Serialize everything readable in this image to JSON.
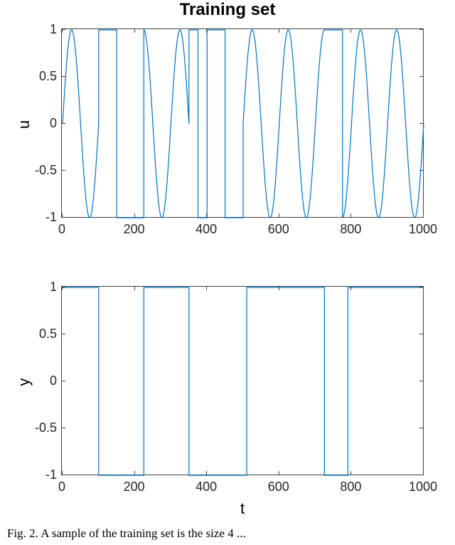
{
  "title": "Training set",
  "caption": "Fig. 2.  A sample of the training set is the size 4 ...",
  "chart_data": [
    {
      "type": "line",
      "title": "Training set",
      "xlabel": "",
      "ylabel": "u",
      "xlim": [
        0,
        1000
      ],
      "ylim": [
        -1,
        1
      ],
      "xticks": [
        0,
        200,
        400,
        600,
        800,
        1000
      ],
      "yticks": [
        -1,
        -0.5,
        0,
        0.5,
        1
      ],
      "description": "sinusoid (period≈100) alternating or clipped to a square wave at ±1",
      "segments": [
        {
          "kind": "sin",
          "from": 0,
          "to": 100,
          "period": 100
        },
        {
          "kind": "square",
          "from": 100,
          "to": 150,
          "value": 1
        },
        {
          "kind": "square",
          "from": 150,
          "to": 225,
          "value": -1
        },
        {
          "kind": "sin",
          "from": 225,
          "to": 350,
          "period": 100,
          "phase": 25
        },
        {
          "kind": "square",
          "from": 350,
          "to": 375,
          "value": 1
        },
        {
          "kind": "square",
          "from": 375,
          "to": 400,
          "value": -1
        },
        {
          "kind": "square",
          "from": 400,
          "to": 450,
          "value": 1
        },
        {
          "kind": "square",
          "from": 450,
          "to": 500,
          "value": -1
        },
        {
          "kind": "sin",
          "from": 500,
          "to": 725,
          "period": 100,
          "phase": 0
        },
        {
          "kind": "square",
          "from": 725,
          "to": 775,
          "value": 1
        },
        {
          "kind": "sin",
          "from": 775,
          "to": 1000,
          "period": 100,
          "phase": 75
        }
      ]
    },
    {
      "type": "line",
      "title": "",
      "xlabel": "t",
      "ylabel": "y",
      "xlim": [
        0,
        1000
      ],
      "ylim": [
        -1,
        1
      ],
      "xticks": [
        0,
        200,
        400,
        600,
        800,
        1000
      ],
      "yticks": [
        -1,
        -0.5,
        0,
        0.5,
        1
      ],
      "description": "piecewise constant at ±1 (step response)",
      "steps": [
        {
          "t": 0,
          "y": 1
        },
        {
          "t": 100,
          "y": -1
        },
        {
          "t": 225,
          "y": 1
        },
        {
          "t": 350,
          "y": -1
        },
        {
          "t": 510,
          "y": 1
        },
        {
          "t": 725,
          "y": -1
        },
        {
          "t": 790,
          "y": 1
        },
        {
          "t": 1000,
          "y": 1
        }
      ]
    }
  ]
}
